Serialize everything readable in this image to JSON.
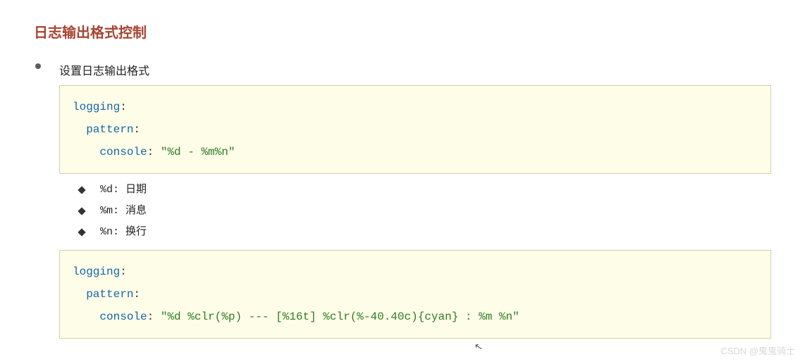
{
  "heading": "日志输出格式控制",
  "item_label": "设置日志输出格式",
  "code1": {
    "key1": "logging",
    "key2": "pattern",
    "key3": "console",
    "value": "\"%d - %m%n\""
  },
  "notes": [
    "%d: 日期",
    "%m: 消息",
    "%n: 换行"
  ],
  "code2": {
    "key1": "logging",
    "key2": "pattern",
    "key3": "console",
    "value": "\"%d %clr(%p) --- [%16t] %clr(%-40.40c){cyan} : %m %n\""
  },
  "watermark": "CSDN @鬼鬼骑士"
}
